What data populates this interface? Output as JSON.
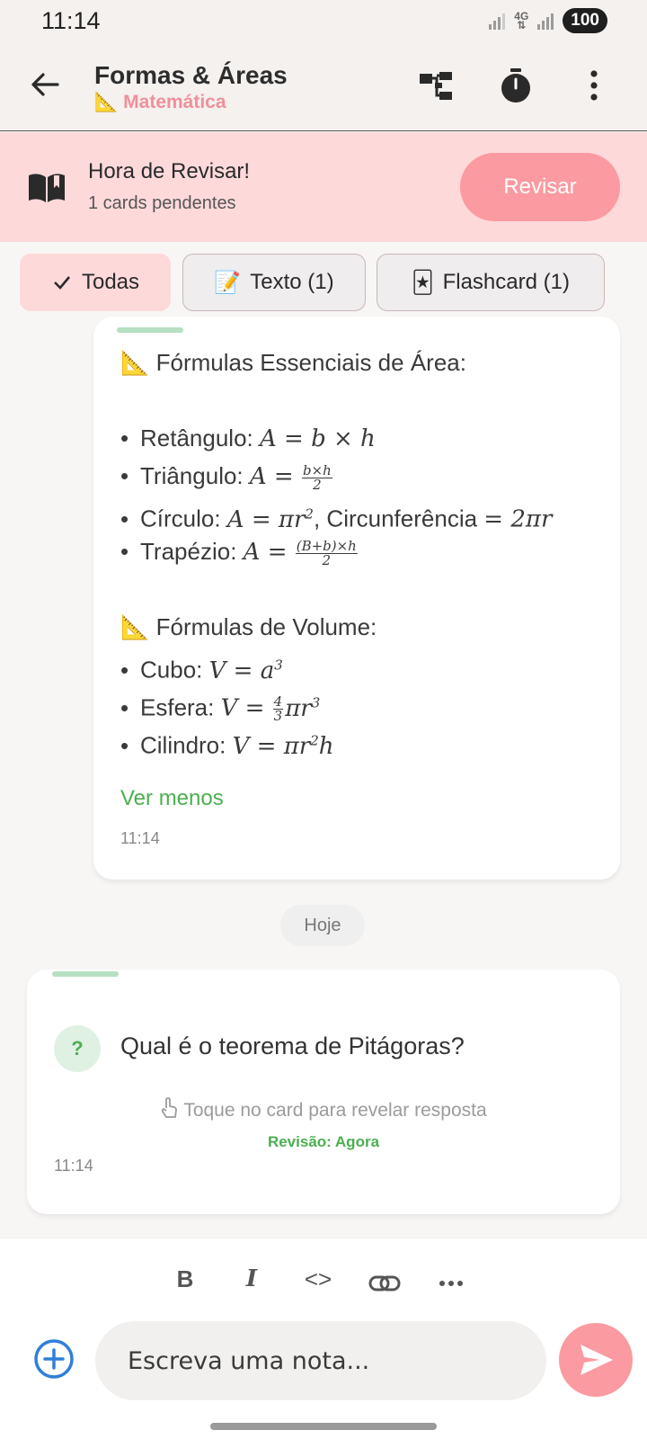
{
  "status_bar": {
    "time": "11:14",
    "network": "4G",
    "battery": "100"
  },
  "header": {
    "title": "Formas & Áreas",
    "subtitle_emoji": "📐",
    "subtitle": "Matemática",
    "icons": [
      "back-arrow-icon",
      "mind-map-icon",
      "timer-icon",
      "more-vert-icon"
    ]
  },
  "review_banner": {
    "title": "Hora de Revisar!",
    "subtitle": "1 cards pendentes",
    "button_label": "Revisar",
    "icon": "book-open-icon"
  },
  "filters": [
    {
      "label": "Todas",
      "emoji": "",
      "active": true
    },
    {
      "label": "Texto (1)",
      "emoji": "📝",
      "active": false
    },
    {
      "label": "Flashcard (1)",
      "emoji": "🃏",
      "active": false
    }
  ],
  "note": {
    "heading1_emoji": "📐",
    "heading1": "Fórmulas Essenciais de Área:",
    "area_items": [
      {
        "label": "Retângulo:"
      },
      {
        "label": "Triângulo:"
      },
      {
        "label": "Círculo:",
        "extra": "Circunferência"
      },
      {
        "label": "Trapézio:"
      }
    ],
    "heading2_emoji": "📐",
    "heading2": "Fórmulas de Volume:",
    "volume_items": [
      {
        "label": "Cubo:"
      },
      {
        "label": "Esfera:"
      },
      {
        "label": "Cilindro:"
      }
    ],
    "toggle_label": "Ver menos",
    "time": "11:14"
  },
  "date_separator": "Hoje",
  "flashcard": {
    "question": "Qual é o teorema de Pitágoras?",
    "icon_text": "?",
    "hint": "Toque no card para revelar resposta",
    "review_due": "Revisão: Agora",
    "time": "11:14"
  },
  "composer": {
    "format_buttons": [
      "B",
      "I",
      "<>",
      "link",
      "..."
    ],
    "placeholder": "Escreva uma nota...",
    "accent_color": "#fb9aa0",
    "success_color": "#4caf50"
  }
}
